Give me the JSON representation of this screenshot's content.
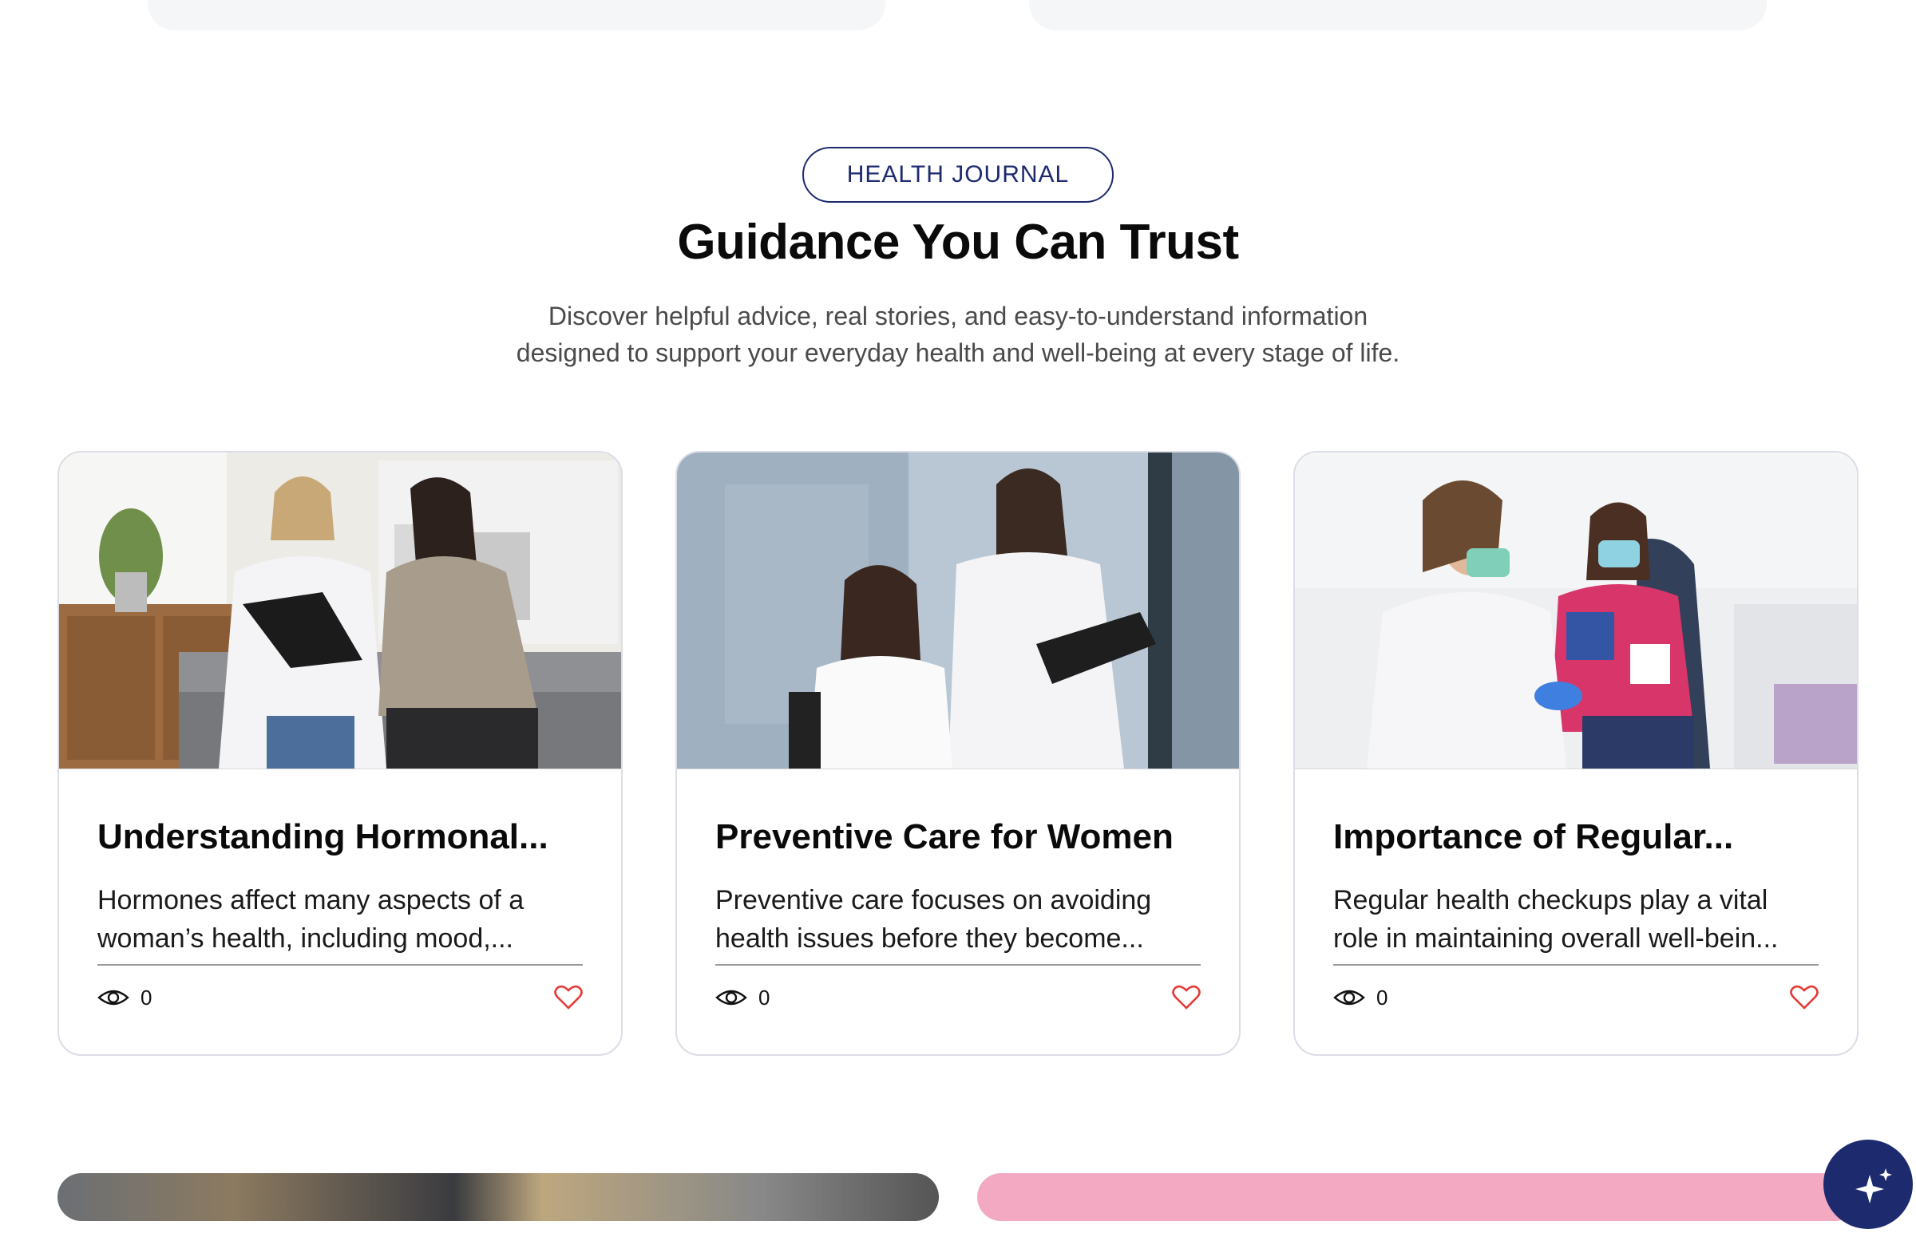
{
  "section": {
    "badge": "HEALTH JOURNAL",
    "title": "Guidance You Can Trust",
    "subtitle": "Discover helpful advice, real stories, and easy-to-understand information designed to support your everyday health and well-being at every stage of life."
  },
  "articles": [
    {
      "title": "Understanding Hormonal...",
      "excerpt": "Hormones affect many aspects of a woman’s health, including mood,...",
      "views": "0",
      "image_icon": "doctor-consultation-photo"
    },
    {
      "title": "Preventive Care for Women",
      "excerpt": "Preventive care focuses on avoiding health issues before they become...",
      "views": "0",
      "image_icon": "doctor-patient-photo"
    },
    {
      "title": "Importance of Regular...",
      "excerpt": "Regular health checkups play a vital role in maintaining overall well-bein...",
      "views": "0",
      "image_icon": "blood-test-photo"
    }
  ],
  "icons": {
    "views": "eye-icon",
    "like": "heart-icon",
    "assistant": "sparkle-icon"
  },
  "colors": {
    "accent": "#1e2a6e",
    "heart": "#e53935",
    "card_border": "#dcdde6"
  }
}
